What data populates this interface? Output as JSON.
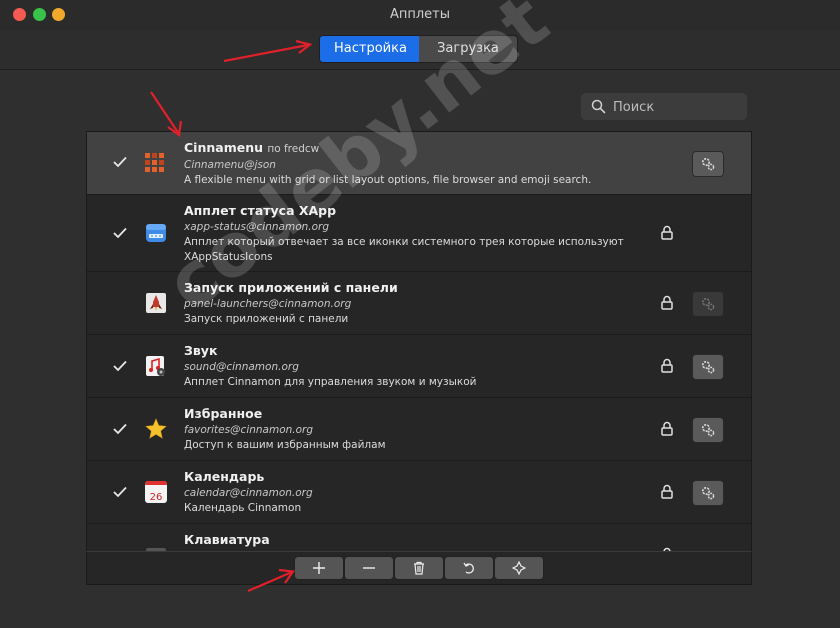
{
  "window": {
    "title": "Апплеты"
  },
  "tabs": [
    {
      "label": "Настройка",
      "active": true
    },
    {
      "label": "Загрузка",
      "active": false
    }
  ],
  "search": {
    "placeholder": "Поиск",
    "value": ""
  },
  "applets": [
    {
      "name": "Cinnamenu",
      "author": "по fredcw",
      "uuid": "Cinnamenu@json",
      "description": "A flexible menu with grid or list layout options, file browser and emoji search.",
      "enabled": true,
      "locked": false,
      "configurable": true,
      "icon": "cinnamenu-grid-icon"
    },
    {
      "name": "Апплет статуса XApp",
      "author": "",
      "uuid": "xapp-status@cinnamon.org",
      "description": "Апплет который отвечает за все иконки системного трея которые используют XAppStatusIcons",
      "enabled": true,
      "locked": true,
      "configurable": false,
      "icon": "xapp-status-icon"
    },
    {
      "name": "Запуск приложений с панели",
      "author": "",
      "uuid": "panel-launchers@cinnamon.org",
      "description": "Запуск приложений с панели",
      "enabled": false,
      "locked": true,
      "configurable": true,
      "icon": "rocket-icon"
    },
    {
      "name": "Звук",
      "author": "",
      "uuid": "sound@cinnamon.org",
      "description": "Апплет Cinnamon для управления звуком и музыкой",
      "enabled": true,
      "locked": true,
      "configurable": true,
      "icon": "sound-icon"
    },
    {
      "name": "Избранное",
      "author": "",
      "uuid": "favorites@cinnamon.org",
      "description": "Доступ к вашим избранным файлам",
      "enabled": true,
      "locked": true,
      "configurable": true,
      "icon": "star-icon"
    },
    {
      "name": "Календарь",
      "author": "",
      "uuid": "calendar@cinnamon.org",
      "description": "Календарь Cinnamon",
      "enabled": true,
      "locked": true,
      "configurable": true,
      "icon": "calendar-icon",
      "icon_text": "26"
    },
    {
      "name": "Клавиатура",
      "author": "",
      "uuid": "",
      "description": "",
      "enabled": false,
      "locked": true,
      "configurable": false,
      "icon": "keyboard-icon"
    }
  ],
  "toolbar": {
    "buttons": [
      "add-icon",
      "remove-icon",
      "trash-icon",
      "undo-icon",
      "restore-icon"
    ]
  },
  "watermark": {
    "text": "codeby.net"
  },
  "colors": {
    "accent": "#1c6de8",
    "arrow": "#e0202a",
    "star": "#f5c22c"
  }
}
